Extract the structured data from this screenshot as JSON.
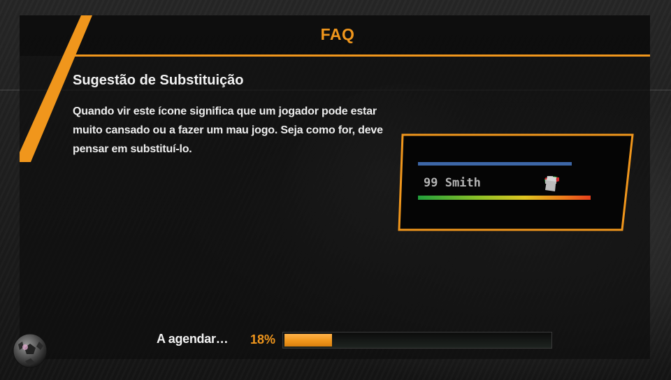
{
  "header": {
    "title": "FAQ"
  },
  "content": {
    "heading": "Sugestão de Substituição",
    "body": "Quando vir este ícone significa que um jogador pode estar muito cansado ou a fazer um mau jogo. Seja como for, deve pensar em substituí-lo."
  },
  "demo": {
    "player_name": "99 Smith",
    "icons": [
      "substitution-green-arrow-icon",
      "substitution-red-arrow-icon",
      "injury-cross-icon",
      "card-icon"
    ]
  },
  "loading": {
    "label": "A agendar…",
    "percent_text": "18%",
    "progress": 0.18
  },
  "colors": {
    "accent": "#f0961c",
    "blue_bar": "#3d67a8"
  }
}
